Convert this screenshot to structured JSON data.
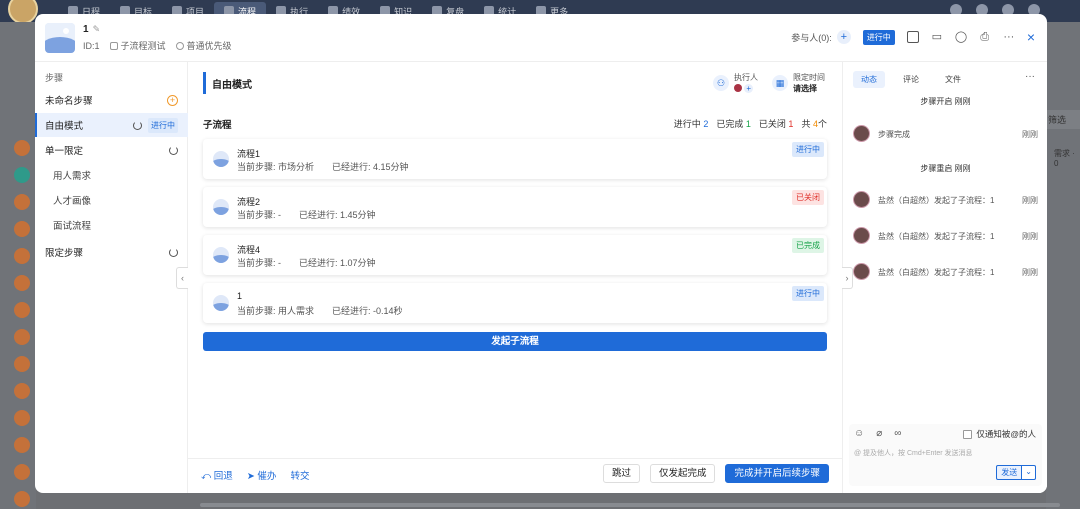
{
  "background": {
    "nav_items": [
      "日程",
      "目标",
      "项目",
      "流程",
      "执行",
      "绩效",
      "知识",
      "复盘",
      "统计",
      "更多"
    ],
    "nav_active": "流程",
    "right_label_1": "筛选",
    "right_label_2": "需求 · 0"
  },
  "header": {
    "title": "1",
    "id": "ID:1",
    "process_name": "子流程测试",
    "priority": "普通优先级",
    "participants_label": "参与人(0):",
    "status_badge": "进行中",
    "close_label": "×"
  },
  "steps": {
    "heading": "步骤",
    "items": [
      {
        "label": "未命名步骤"
      },
      {
        "label": "自由模式",
        "status": "进行中"
      },
      {
        "label": "单一限定"
      },
      {
        "label": "用人需求"
      },
      {
        "label": "人才画像"
      },
      {
        "label": "面试流程"
      },
      {
        "label": "限定步骤"
      }
    ]
  },
  "main": {
    "mode_title": "自由模式",
    "executor_label": "执行人",
    "deadline_label": "限定时间",
    "deadline_value": "请选择",
    "subprocess_heading": "子流程",
    "stats": {
      "in_progress_label": "进行中",
      "in_progress": "2",
      "done_label": "已完成",
      "done": "1",
      "closed_label": "已关闭",
      "closed": "1",
      "total_label": "共",
      "total": "4",
      "total_unit": "个"
    },
    "cards": [
      {
        "name": "流程1",
        "step": "当前步骤: 市场分析",
        "elapsed": "已经进行: 4.15分钟",
        "status": "进行中"
      },
      {
        "name": "流程2",
        "step": "当前步骤: -",
        "elapsed": "已经进行: 1.45分钟",
        "status": "已关闭"
      },
      {
        "name": "流程4",
        "step": "当前步骤: -",
        "elapsed": "已经进行: 1.07分钟",
        "status": "已完成"
      },
      {
        "name": "1",
        "step": "当前步骤: 用人需求",
        "elapsed": "已经进行: -0.14秒",
        "status": "进行中"
      }
    ],
    "launch_label": "发起子流程",
    "footer": {
      "rollback": "回退",
      "urge": "催办",
      "transfer": "转交",
      "skip": "跳过",
      "launch_only": "仅发起完成",
      "complete_next": "完成并开启后续步骤"
    }
  },
  "side": {
    "tabs": [
      "动态",
      "评论",
      "文件"
    ],
    "events": [
      {
        "type": "center",
        "text": "步骤开启 刚刚"
      },
      {
        "type": "act",
        "text": "步骤完成",
        "time": "刚刚"
      },
      {
        "type": "center",
        "text": "步骤重启 刚刚"
      },
      {
        "type": "act",
        "text": "盐然（白超然）发起了子流程：1",
        "time": "刚刚"
      },
      {
        "type": "act",
        "text": "盐然（白超然）发起了子流程：1",
        "time": "刚刚"
      },
      {
        "type": "act",
        "text": "盐然（白超然）发起了子流程：1",
        "time": "刚刚"
      }
    ],
    "notify_label": "仅通知被@的人",
    "placeholder": "@ 提及他人，按 Cmd+Enter 发送消息",
    "send_label": "发送"
  }
}
